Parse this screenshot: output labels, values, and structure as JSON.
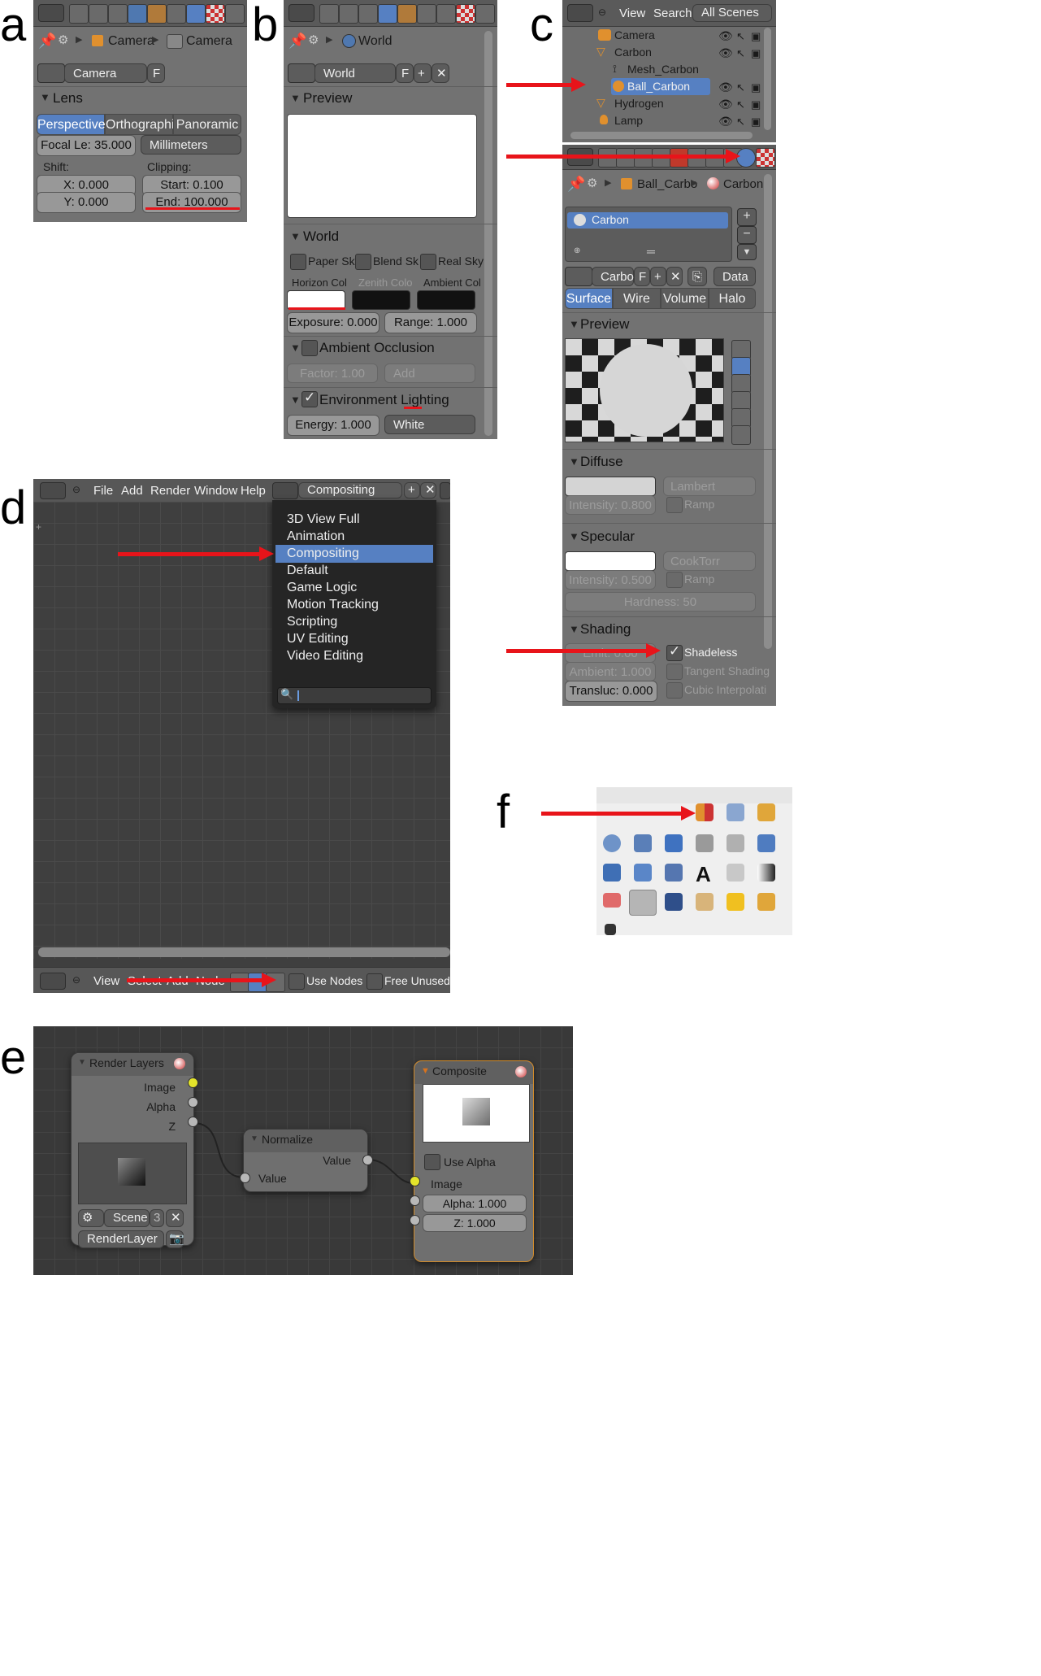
{
  "panel_labels": {
    "a": "a",
    "b": "b",
    "c": "c",
    "d": "d",
    "e": "e",
    "f": "f"
  },
  "colors": {
    "accent": "#5680c2",
    "arrow": "#e8141a",
    "panel_bg": "#727272",
    "socket_yellow": "#e4e42a"
  },
  "panel_a": {
    "breadcrumb": {
      "first": "Camera",
      "second": "Camera"
    },
    "datablock": {
      "name": "Camera",
      "fake_user": "F"
    },
    "lens": {
      "header": "Lens",
      "tabs": [
        "Perspective",
        "Orthographic",
        "Panoramic"
      ],
      "active_tab": "Perspective",
      "focal": "Focal Le: 35.000",
      "units": "Millimeters",
      "shift_label": "Shift:",
      "clipping_label": "Clipping:",
      "shift_x": "X: 0.000",
      "shift_y": "Y: 0.000",
      "clip_start": "Start: 0.100",
      "clip_end": "End: 100.000"
    }
  },
  "panel_b": {
    "breadcrumb": "World",
    "datablock": {
      "name": "World",
      "fake_user": "F"
    },
    "preview_header": "Preview",
    "world_header": "World",
    "checks": [
      "Paper Sk",
      "Blend Sk",
      "Real Sky"
    ],
    "color_labels": [
      "Horizon Col",
      "Zenith Colo",
      "Ambient Col"
    ],
    "exposure": "Exposure: 0.000",
    "range": "Range: 1.000",
    "ao_header": "Ambient Occlusion",
    "ao_factor": "Factor: 1.00",
    "ao_mode": "Add",
    "env_header": "Environment Lighting",
    "energy": "Energy: 1.000",
    "env_color": "White"
  },
  "panel_c": {
    "outliner": {
      "menu": [
        "View",
        "Search"
      ],
      "scene_select": "All Scenes",
      "rows": [
        "Camera",
        "Carbon",
        "Mesh_Carbon",
        "Ball_Carbon",
        "Hydrogen",
        "Lamp"
      ]
    },
    "breadcrumb": {
      "object": "Ball_Carbo",
      "material": "Carbon"
    },
    "material_slot": "Carbon",
    "datablock": {
      "name": "Carbon",
      "fake_user": "F",
      "link": "Data"
    },
    "tabs": [
      "Surface",
      "Wire",
      "Volume",
      "Halo"
    ],
    "active_tab": "Surface",
    "preview_header": "Preview",
    "diffuse": {
      "header": "Diffuse",
      "shader": "Lambert",
      "intensity": "Intensity: 0.800",
      "ramp": "Ramp"
    },
    "specular": {
      "header": "Specular",
      "shader": "CookTorr",
      "intensity": "Intensity: 0.500",
      "ramp": "Ramp",
      "hardness": "Hardness: 50"
    },
    "shading": {
      "header": "Shading",
      "emit": "Emit: 0.00",
      "shadeless": "Shadeless",
      "ambient": "Ambient: 1.000",
      "tangent": "Tangent Shading",
      "transluc": "Transluc: 0.000",
      "cubic": "Cubic Interpolati"
    }
  },
  "panel_d": {
    "menu": [
      "File",
      "Add",
      "Render",
      "Window",
      "Help"
    ],
    "layout_select": "Compositing",
    "layouts": [
      "3D View Full",
      "Animation",
      "Compositing",
      "Default",
      "Game Logic",
      "Motion Tracking",
      "Scripting",
      "UV Editing",
      "Video Editing"
    ],
    "selected_layout": "Compositing",
    "search_placeholder": "",
    "footer": {
      "menu": [
        "View",
        "Select",
        "Add",
        "Node"
      ],
      "use_nodes": "Use Nodes",
      "free_unused": "Free Unused"
    }
  },
  "panel_e": {
    "render_layers": {
      "title": "Render Layers",
      "outputs": [
        "Image",
        "Alpha",
        "Z"
      ],
      "scene": "Scene",
      "scene_users": "3",
      "layer": "RenderLayer"
    },
    "normalize": {
      "title": "Normalize",
      "output": "Value",
      "input": "Value"
    },
    "composite": {
      "title": "Composite",
      "use_alpha": "Use Alpha",
      "input": "Image",
      "alpha": "Alpha: 1.000",
      "z": "Z: 1.000"
    }
  }
}
